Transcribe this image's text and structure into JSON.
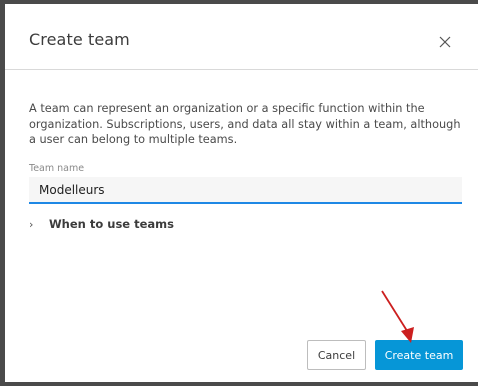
{
  "dialog": {
    "title": "Create team",
    "close_label": "×",
    "description": "A team can represent an organization or a specific function within the organization. Subscriptions, users, and data all stay within a team, although a user can belong to multiple teams.",
    "team_name": {
      "label": "Team name",
      "value": "Modelleurs"
    },
    "accordion": {
      "chevron": "›",
      "label": "When to use teams",
      "expanded": false
    },
    "buttons": {
      "cancel": "Cancel",
      "create": "Create team"
    }
  },
  "icons": {
    "close": "close-icon",
    "chevron": "chevron-right-icon",
    "arrow": "red-annotation-arrow"
  },
  "colors": {
    "primary_button": "#0696d7",
    "field_underline": "#1e88e5",
    "annotation_arrow": "#cc1f1f",
    "backdrop": "#4a4a4a"
  }
}
